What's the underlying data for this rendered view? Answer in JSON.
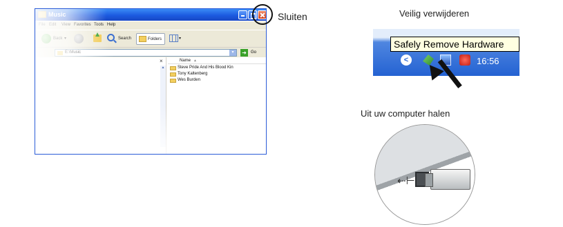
{
  "explorer": {
    "title": "Music",
    "menu": [
      "File",
      "Edit",
      "View",
      "Favorites",
      "Tools",
      "Help"
    ],
    "toolbar": {
      "back": "Back",
      "search": "Search",
      "folders": "Folders",
      "dropdown": "▾"
    },
    "address": {
      "value": "E:\\Music",
      "go": "Go"
    },
    "panel_close": "×",
    "columns": {
      "name": "Name",
      "sort": "▲"
    },
    "files": [
      "Steve Pride And His Blood Kin",
      "Tony Kaltenberg",
      "Wes Burden"
    ]
  },
  "callouts": {
    "close": "Sluiten",
    "safe_remove": "Veilig verwijderen",
    "remove_from_computer": "Uit uw computer halen"
  },
  "tray": {
    "tooltip": "Safely Remove Hardware",
    "chevron": "<",
    "time": "16:56"
  },
  "usb": {
    "symbol": "⇠⊢"
  },
  "icons": [
    "folder-icon",
    "back-icon",
    "forward-icon",
    "up-folder-icon",
    "search-icon",
    "views-icon",
    "go-icon",
    "close-icon",
    "usb-icon",
    "network-icon",
    "security-icon"
  ],
  "colors": {
    "title_bar": "#1c5ae0",
    "close_button": "#d0431b",
    "tooltip": "#ffffe1",
    "taskbar": "#2462d2"
  }
}
